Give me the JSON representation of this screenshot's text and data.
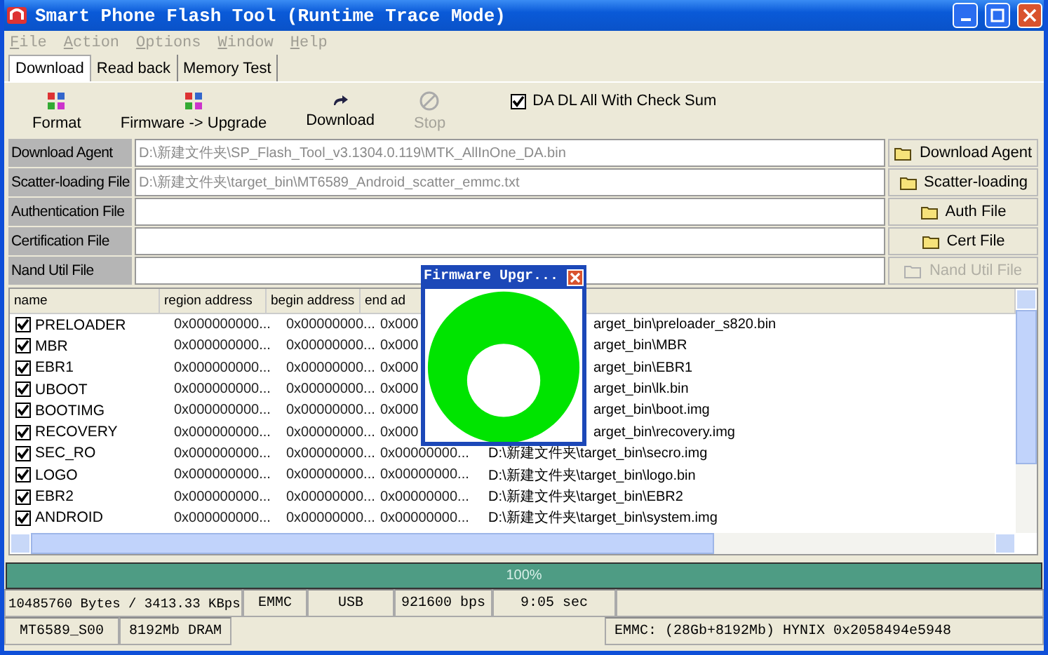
{
  "window": {
    "title": "Smart Phone Flash Tool (Runtime Trace Mode)"
  },
  "menu": [
    {
      "label": "File",
      "disabled": true
    },
    {
      "label": "Action",
      "disabled": true
    },
    {
      "label": "Options",
      "disabled": true
    },
    {
      "label": "Window",
      "disabled": true
    },
    {
      "label": "Help",
      "disabled": true
    }
  ],
  "tabs": [
    {
      "label": "Download",
      "selected": true
    },
    {
      "label": "Read back",
      "selected": false
    },
    {
      "label": "Memory Test",
      "selected": false
    }
  ],
  "toolbar": [
    {
      "label": "Format",
      "kind": "format",
      "disabled": false
    },
    {
      "label": "Firmware -> Upgrade",
      "kind": "format",
      "disabled": false
    },
    {
      "label": "Download",
      "kind": "download",
      "disabled": false
    },
    {
      "label": "Stop",
      "kind": "stop",
      "disabled": true
    }
  ],
  "checksum": {
    "label": "DA DL All With Check Sum",
    "checked": true
  },
  "files": [
    {
      "label": "Download Agent",
      "value": "D:\\新建文件夹\\SP_Flash_Tool_v3.1304.0.119\\MTK_AllInOne_DA.bin",
      "button": "Download Agent",
      "disabled": false
    },
    {
      "label": "Scatter-loading File",
      "value": "D:\\新建文件夹\\target_bin\\MT6589_Android_scatter_emmc.txt",
      "button": "Scatter-loading",
      "disabled": false
    },
    {
      "label": "Authentication File",
      "button": "Auth File",
      "disabled": false
    },
    {
      "label": "Certification File",
      "button": "Cert File",
      "disabled": false
    },
    {
      "label": "Nand Util File",
      "button": "Nand Util File",
      "disabled": true
    }
  ],
  "table": {
    "columns": [
      "name",
      "region address",
      "begin address",
      "end ad"
    ],
    "rows": [
      {
        "name": "PRELOADER",
        "checked": true,
        "region": "0x000000000...",
        "begin": "0x00000000...",
        "end": "0x000",
        "file": "arget_bin\\preloader_s820.bin",
        "covered": true
      },
      {
        "name": "MBR",
        "checked": true,
        "region": "0x000000000...",
        "begin": "0x00000000...",
        "end": "0x000",
        "file": "arget_bin\\MBR",
        "covered": true
      },
      {
        "name": "EBR1",
        "checked": true,
        "region": "0x000000000...",
        "begin": "0x00000000...",
        "end": "0x000",
        "file": "arget_bin\\EBR1",
        "covered": true
      },
      {
        "name": "UBOOT",
        "checked": true,
        "region": "0x000000000...",
        "begin": "0x00000000...",
        "end": "0x000",
        "file": "arget_bin\\lk.bin",
        "covered": true
      },
      {
        "name": "BOOTIMG",
        "checked": true,
        "region": "0x000000000...",
        "begin": "0x00000000...",
        "end": "0x000",
        "file": "arget_bin\\boot.img",
        "covered": true
      },
      {
        "name": "RECOVERY",
        "checked": true,
        "region": "0x000000000...",
        "begin": "0x00000000...",
        "end": "0x000",
        "file": "arget_bin\\recovery.img",
        "covered": true
      },
      {
        "name": "SEC_RO",
        "checked": true,
        "region": "0x000000000...",
        "begin": "0x00000000...",
        "end": "0x00000000...",
        "file": "D:\\新建文件夹\\target_bin\\secro.img",
        "covered": false
      },
      {
        "name": "LOGO",
        "checked": true,
        "region": "0x000000000...",
        "begin": "0x00000000...",
        "end": "0x00000000...",
        "file": "D:\\新建文件夹\\target_bin\\logo.bin",
        "covered": false
      },
      {
        "name": "EBR2",
        "checked": true,
        "region": "0x000000000...",
        "begin": "0x00000000...",
        "end": "0x00000000...",
        "file": "D:\\新建文件夹\\target_bin\\EBR2",
        "covered": false
      },
      {
        "name": "ANDROID",
        "checked": true,
        "region": "0x000000000...",
        "begin": "0x00000000...",
        "end": "0x00000000...",
        "file": "D:\\新建文件夹\\target_bin\\system.img",
        "covered": false
      }
    ]
  },
  "progress": {
    "level": 1,
    "text": "100%"
  },
  "status_bar": {
    "row_1": [
      "10485760 Bytes / 3413.33 KBps",
      "EMMC",
      "USB",
      "921600 bps",
      "9:05 sec"
    ],
    "row_2": [
      "MT6589_S00",
      "8192Mb DRAM",
      "EMMC: (28Gb+8192Mb) HYNIX 0x2058494e5948"
    ]
  },
  "dialog": {
    "title": "Firmware Upgr..."
  }
}
